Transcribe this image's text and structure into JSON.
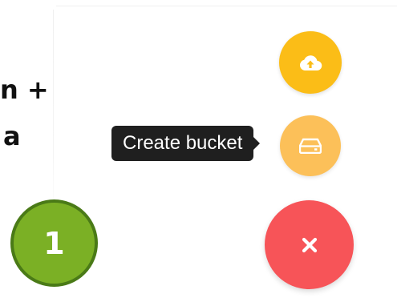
{
  "left_fragment": {
    "line1": "n +",
    "line2": "a"
  },
  "step_badge": {
    "number": "1",
    "fill_color": "#7bb025",
    "border_color": "#4a7a17"
  },
  "fab_menu": {
    "upload": {
      "icon": "cloud-upload-icon",
      "color": "#fbbd17"
    },
    "create_bucket": {
      "icon": "bucket-icon",
      "color": "#fcc059",
      "tooltip": "Create bucket"
    },
    "close": {
      "icon": "close-icon",
      "color": "#f75458"
    }
  }
}
